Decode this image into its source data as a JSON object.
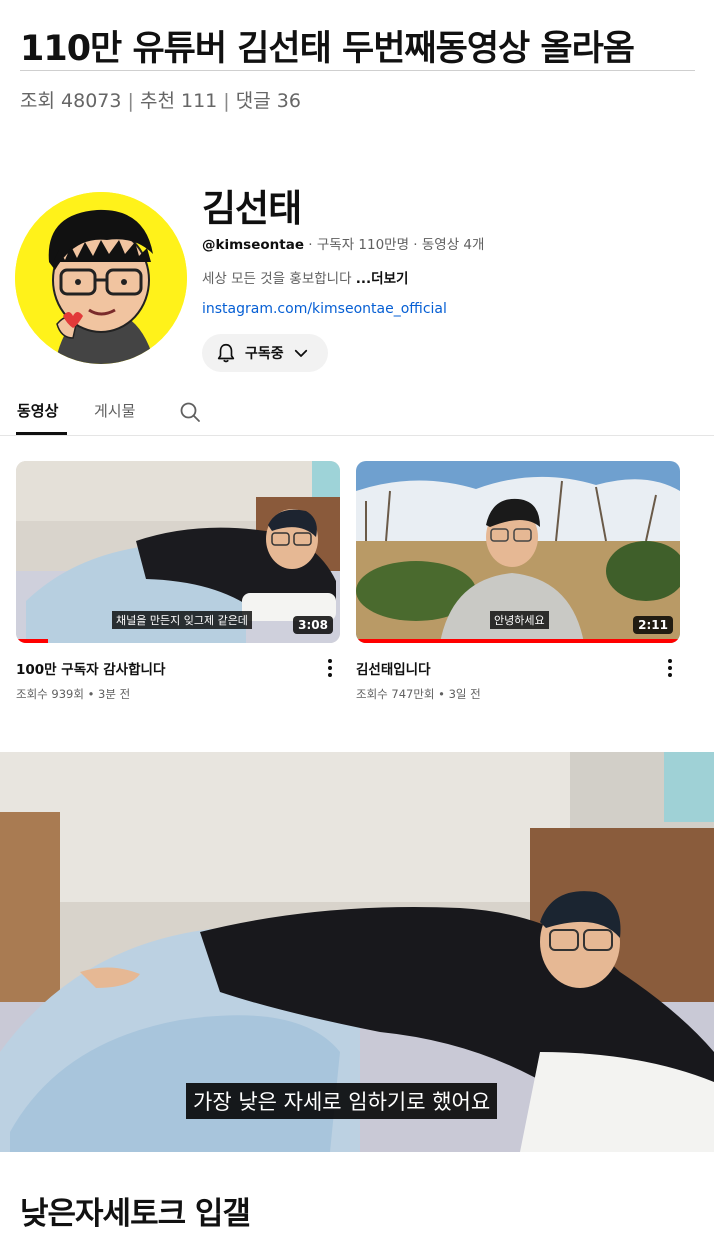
{
  "post": {
    "title": "110만 유튜버 김선태 두번째동영상 올라옴",
    "meta": {
      "views_label": "조회",
      "views": "48073",
      "recommend_label": "추천",
      "recommend": "111",
      "comments_label": "댓글",
      "comments": "36"
    },
    "closing_text": "낮은자세토크 입갤"
  },
  "channel": {
    "name": "김선태",
    "handle": "@kimseontae",
    "stats": "· 구독자 110만명 · 동영상 4개",
    "description": "세상 모든 것을 홍보합니다",
    "more_label": "...더보기",
    "link": "instagram.com/kimseontae_official",
    "subscribe_label": "구독중"
  },
  "tabs": [
    {
      "label": "동영상",
      "active": true
    },
    {
      "label": "게시물",
      "active": false
    }
  ],
  "videos": [
    {
      "title": "100만 구독자 감사합니다",
      "meta": "조회수 939회 • 3분 전",
      "duration": "3:08",
      "caption": "채널을 만든지 잊그제 같은데",
      "progress": 0.1
    },
    {
      "title": "김선태입니다",
      "meta": "조회수 747만회 • 3일 전",
      "duration": "2:11",
      "caption": "안녕하세요",
      "progress": 1.0
    }
  ],
  "still_caption": "가장 낮은 자세로 임하기로 했어요",
  "colors": {
    "accent_red": "#ff0000",
    "link_blue": "#065fd4",
    "avatar_yellow": "#fff21a"
  },
  "icons": [
    "bell-icon",
    "chevron-down-icon",
    "search-icon",
    "more-vert-icon"
  ]
}
